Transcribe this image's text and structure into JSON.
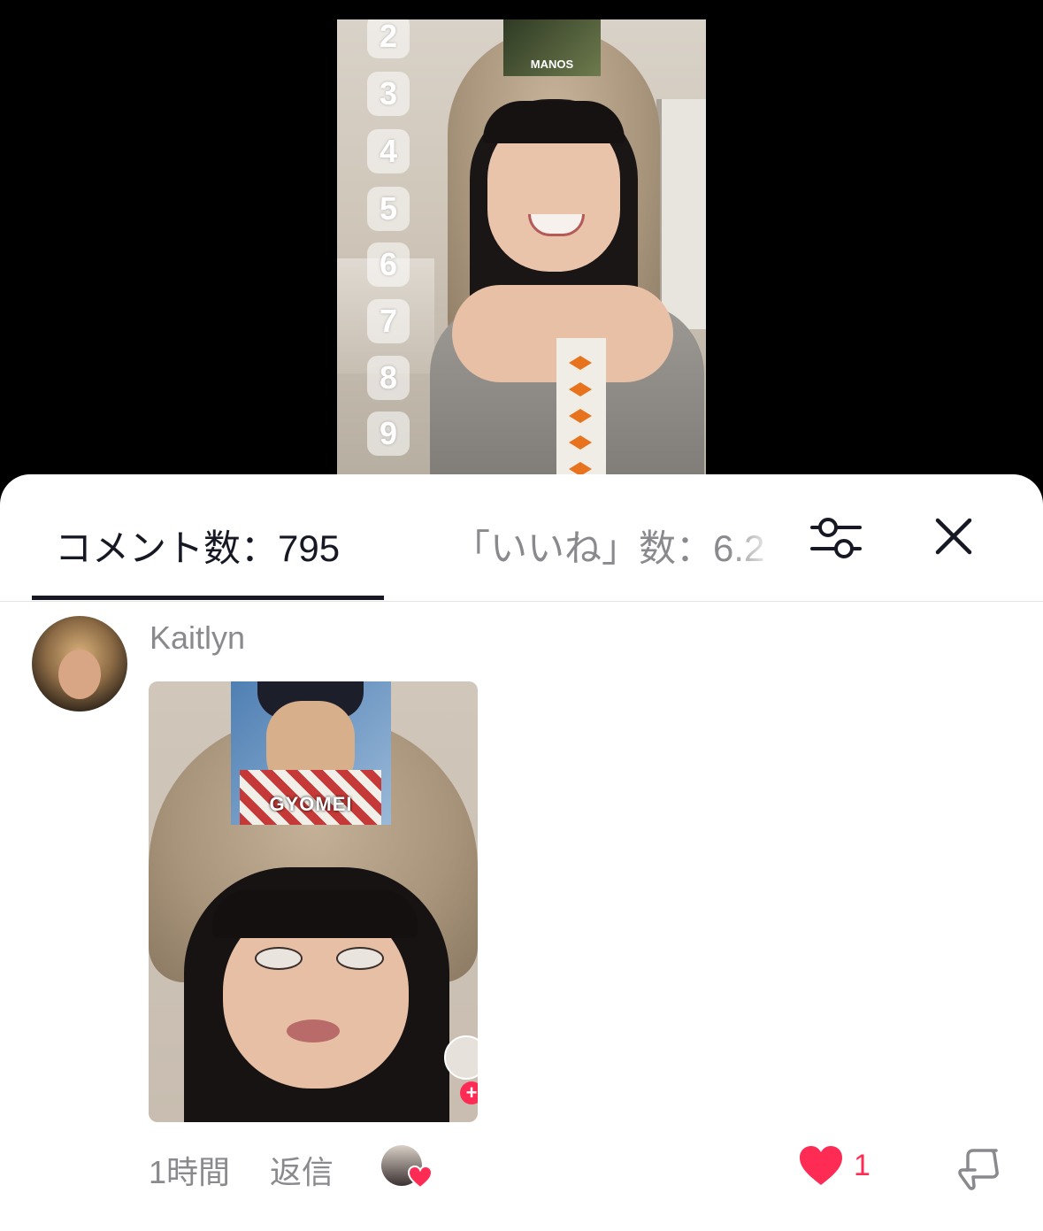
{
  "video": {
    "sticker_text": "MANOS",
    "numbers": [
      "2",
      "3",
      "4",
      "5",
      "6",
      "7",
      "8",
      "9"
    ]
  },
  "sheet": {
    "tabs": [
      {
        "label": "コメント数：795",
        "active": true
      },
      {
        "label": "「いいね」数：6.2",
        "active": false
      }
    ],
    "filter_icon": "sliders-icon",
    "close_icon": "close-icon"
  },
  "comment": {
    "username": "Kaitlyn",
    "video_sticker_text": "GYOMEI",
    "time": "1時間",
    "reply_label": "返信",
    "like_count": "1",
    "colors": {
      "like": "#fe2c55",
      "muted": "#8a8a8e",
      "text": "#161823"
    }
  }
}
